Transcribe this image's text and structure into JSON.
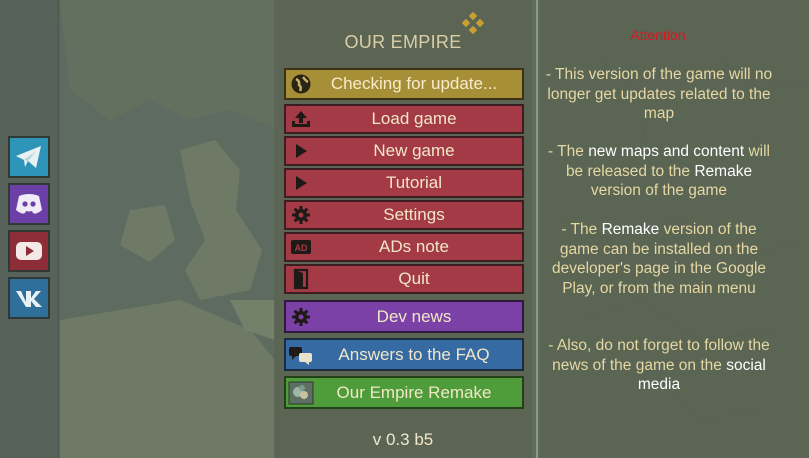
{
  "menu": {
    "title": "OUR EMPIRE",
    "buttons": [
      {
        "label": "Checking for update...",
        "icon": "globe-icon",
        "color": "#a68f37"
      },
      {
        "label": "Load game",
        "icon": "upload-icon",
        "color": "#a43a45"
      },
      {
        "label": "New game",
        "icon": "play-icon",
        "color": "#a43a45"
      },
      {
        "label": "Tutorial",
        "icon": "play-icon",
        "color": "#a43a45"
      },
      {
        "label": "Settings",
        "icon": "gear-icon",
        "color": "#a43a45"
      },
      {
        "label": "ADs note",
        "icon": "ad-icon",
        "color": "#a43a45"
      },
      {
        "label": "Quit",
        "icon": "exit-door-icon",
        "color": "#a43a45"
      },
      {
        "label": "Dev news",
        "icon": "gear-news-icon",
        "color": "#7c41a7"
      },
      {
        "label": "Answers to the FAQ",
        "icon": "chat-bubbles-icon",
        "color": "#366aa2"
      },
      {
        "label": "Our Empire Remake",
        "icon": "remake-thumbnail-icon",
        "color": "#4f9c3a"
      }
    ],
    "version": "v 0.3 b5"
  },
  "social": [
    {
      "name": "telegram",
      "icon": "telegram-icon",
      "color": "#2e95b9"
    },
    {
      "name": "discord",
      "icon": "discord-icon",
      "color": "#6a3fa6"
    },
    {
      "name": "youtube",
      "icon": "youtube-icon",
      "color": "#8c2d37"
    },
    {
      "name": "vk",
      "icon": "vk-icon",
      "color": "#2f6f9a"
    }
  ],
  "info": {
    "attention": "Attention",
    "p1": "- This version of the game will no longer get updates related to the map",
    "p2_a": "- The ",
    "p2_b": "new maps and content",
    "p2_c": " will be released to the ",
    "p2_d": "Remake",
    "p2_e": " version of the game",
    "p3_a": "- The ",
    "p3_b": "Remake",
    "p3_c": " version of the game can be installed on the developer's page in the Google Play, or from the main menu",
    "p4_a": "- Also, do not forget to follow the news of the game on the ",
    "p4_b": "social media"
  }
}
